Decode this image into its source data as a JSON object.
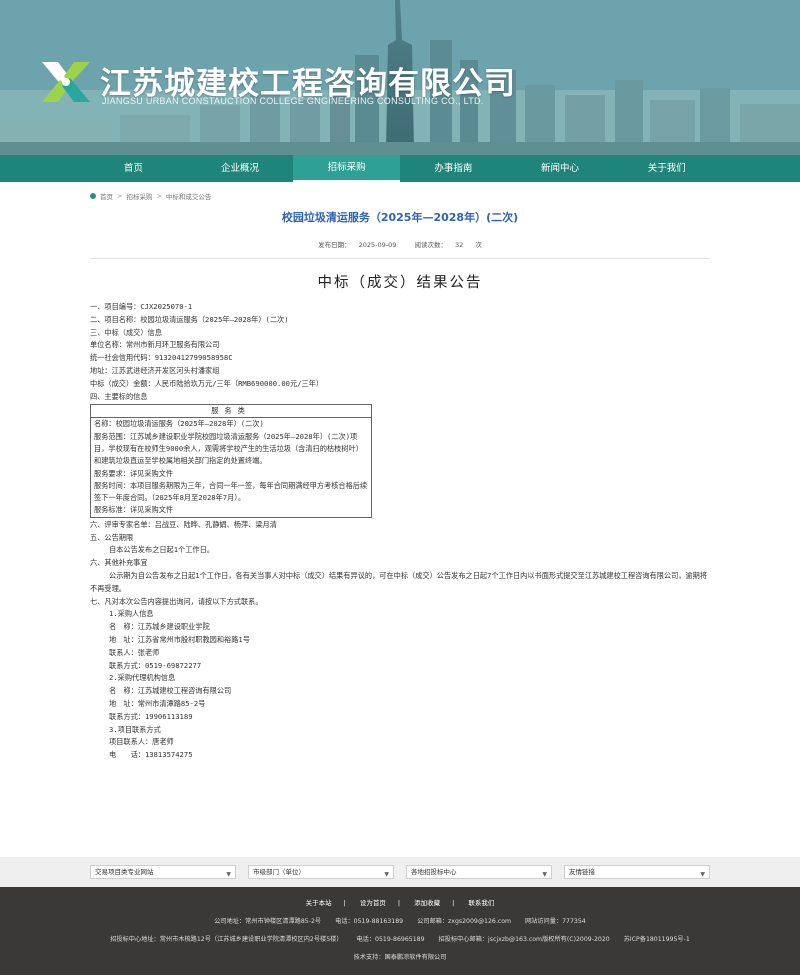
{
  "header": {
    "cn_name": "江苏城建校工程咨询有限公司",
    "en_name": "JIANGSU URBAN CONSTAUCTION COLLEGE GNGINEERING CONSULTING CO., LTD.",
    "brand_color": "#1f8479"
  },
  "nav": {
    "items": [
      {
        "label": "首页"
      },
      {
        "label": "企业概况"
      },
      {
        "label": "招标采购"
      },
      {
        "label": "办事指南"
      },
      {
        "label": "新闻中心"
      },
      {
        "label": "关于我们"
      }
    ],
    "active_index": 2
  },
  "breadcrumb": {
    "home": "首页",
    "level1": "招标采购",
    "level2": "中标和成交公告",
    "icon": "location-pin-icon"
  },
  "article": {
    "title": "校园垃圾清运服务（2025年—2028年）(二次)",
    "publish_label": "发布日期：",
    "publish_date": "2025-09-09",
    "views_label": "阅读次数：",
    "views": "32",
    "views_unit": "次",
    "doc_title": "中标（成交）结果公告",
    "title_color": "#2f63b5"
  },
  "body": {
    "l1": "一、项目编号：CJX2025070-1",
    "l2": "二、项目名称：校园垃圾清运服务（2025年—2028年）(二次)",
    "l3": "三、中标（成交）信息",
    "l4": "单位名称：常州市新月环卫服务有限公司",
    "l5": "统一社会信用代码：91320412799058958C",
    "l6": "地址：江苏武进经济开发区河头村潘家组",
    "l7": "中标（成交）金额：人民币陆拾玖万元/三年（RMB690000.00元/三年）",
    "l8": "四、主要标的信息",
    "svc_head": "服务类",
    "svc1": "名称：校园垃圾清运服务（2025年—2028年）(二次)",
    "svc2": "服务范围：江苏城乡建设职业学院校园垃圾清运服务（2025年—2028年）(二次)项目，学校现有在校师生9000余人，观需将学校产生的生活垃圾（含清扫的枯枝树叶）和建筑垃圾直运至学校属地相关部门指定的处置终端。",
    "svc3": "服务要求：详见采购文件",
    "svc4": "服务时间：本项目服务期限为三年，合同一年一签，每年合同期满经甲方考核合格后续签下一年度合同。（2025年8月至2028年7月）。",
    "svc5": "服务标准：详见采购文件",
    "l9": "六、评审专家名单：吕战豆、陆晔、孔静娟、杨萍、梁月清",
    "l10": "五、公告期限",
    "l11": "自本公告发布之日起1个工作日。",
    "l12": "六、其他补充事宜",
    "l13": "公示期为自公告发布之日起1个工作日，各有关当事人对中标（成交）结果有异议的，可在中标（成交）公告发布之日起7个工作日内以书面形式提交至江苏城建校工程咨询有限公司，逾期将不再受理。",
    "l14": "七、凡对本次公告内容提出询问，请按以下方式联系。",
    "l15": "1.采购人信息",
    "l16": "名　称：江苏城乡建设职业学院",
    "l17": "地　址：江苏省常州市殷村职教园和裕路1号",
    "l18": "联系人：张老师",
    "l19": "联系方式：0519-69872277",
    "l20": "2.采购代理机构信息",
    "l21": "名　称：江苏城建校工程咨询有限公司",
    "l22": "地　址：常州市清潭路85-2号",
    "l23": "联系方式：19906113189",
    "l24": "3.项目联系方式",
    "l25": "项目联系人：唐老师",
    "l26": "电　　话：13813574275"
  },
  "links_bar": {
    "selects": [
      {
        "value": "交易项目类专业网站"
      },
      {
        "value": "市级部门（单位）"
      },
      {
        "value": "各地招投标中心"
      },
      {
        "value": "友情链接"
      }
    ]
  },
  "footer": {
    "links": [
      "关于本站",
      "设为首页",
      "添加收藏",
      "联系我们"
    ],
    "row1": [
      "公司地址：常州市钟楼区清潭路85-2号",
      "电话：0519-88163189",
      "公司邮箱：zxgs2009@126.com",
      "网站访问量：777354"
    ],
    "row2": [
      "招投标中心地址：常州市木梳路12号（江苏城乡建设职业学院清潭校区内2号楼5楼）",
      "电话：0519-86965189",
      "招投标中心邮箱：jscjxzb@163.com版权所有(C)2009-2020",
      "苏ICP备18011995号-1"
    ],
    "row3": "技术支持：国泰鹏凉软件有限公司"
  }
}
